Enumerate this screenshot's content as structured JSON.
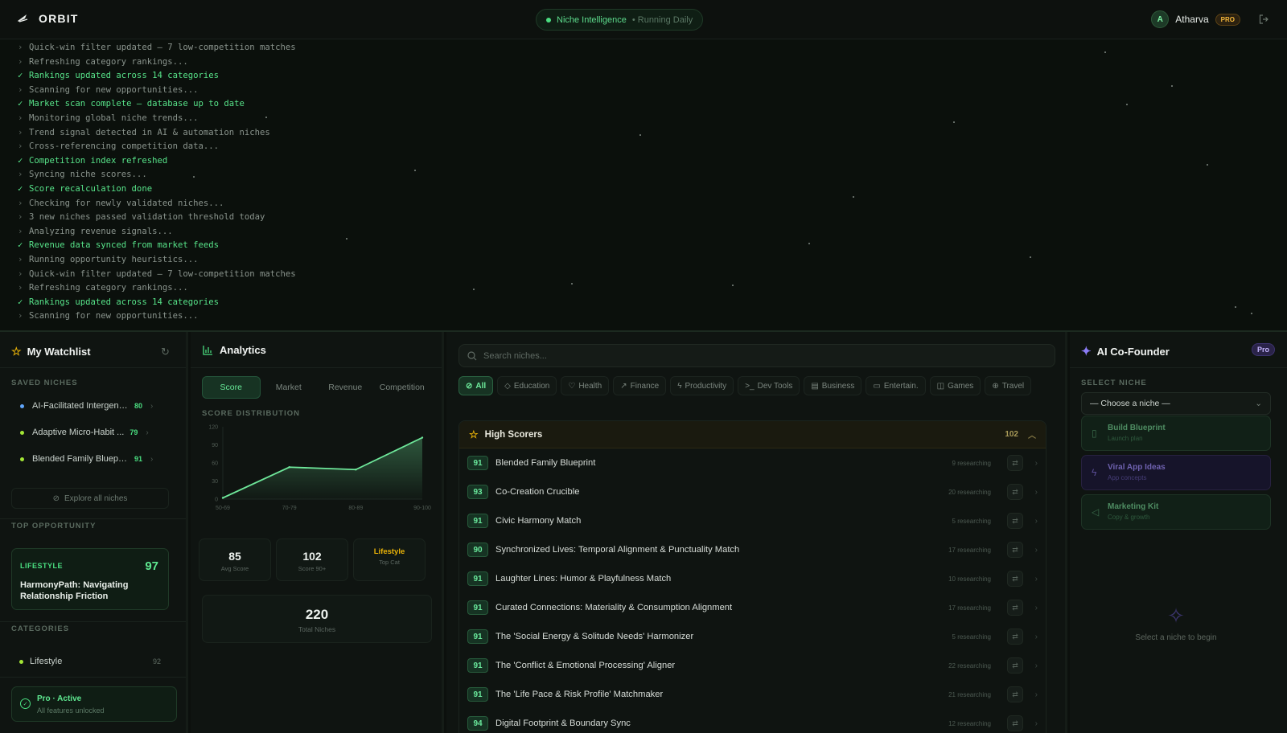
{
  "header": {
    "brand": "ORBIT",
    "status_pill": {
      "label": "Niche Intelligence",
      "sub": "• Running Daily"
    },
    "user": {
      "initial": "A",
      "name": "Atharva",
      "badge": "PRO"
    }
  },
  "terminal": {
    "lines": [
      {
        "kind": "info",
        "prefix": "›",
        "text": "Quick-win filter updated — 7 low-competition matches"
      },
      {
        "kind": "info",
        "prefix": "›",
        "text": "Refreshing category rankings..."
      },
      {
        "kind": "ok",
        "prefix": "✓",
        "text": "Rankings updated across 14 categories"
      },
      {
        "kind": "info",
        "prefix": "›",
        "text": "Scanning for new opportunities..."
      },
      {
        "kind": "ok",
        "prefix": "✓",
        "text": "Market scan complete — database up to date"
      },
      {
        "kind": "info",
        "prefix": "›",
        "text": "Monitoring global niche trends..."
      },
      {
        "kind": "info",
        "prefix": "›",
        "text": "Trend signal detected in AI & automation niches"
      },
      {
        "kind": "info",
        "prefix": "›",
        "text": "Cross-referencing competition data..."
      },
      {
        "kind": "ok",
        "prefix": "✓",
        "text": "Competition index refreshed"
      },
      {
        "kind": "info",
        "prefix": "›",
        "text": "Syncing niche scores..."
      },
      {
        "kind": "ok",
        "prefix": "✓",
        "text": "Score recalculation done"
      },
      {
        "kind": "info",
        "prefix": "›",
        "text": "Checking for newly validated niches..."
      },
      {
        "kind": "info",
        "prefix": "›",
        "text": "3 new niches passed validation threshold today"
      },
      {
        "kind": "info",
        "prefix": "›",
        "text": "Analyzing revenue signals..."
      },
      {
        "kind": "ok",
        "prefix": "✓",
        "text": "Revenue data synced from market feeds"
      },
      {
        "kind": "info",
        "prefix": "›",
        "text": "Running opportunity heuristics..."
      },
      {
        "kind": "info",
        "prefix": "›",
        "text": "Quick-win filter updated — 7 low-competition matches"
      },
      {
        "kind": "info",
        "prefix": "›",
        "text": "Refreshing category rankings..."
      },
      {
        "kind": "ok",
        "prefix": "✓",
        "text": "Rankings updated across 14 categories"
      },
      {
        "kind": "info",
        "prefix": "›",
        "text": "Scanning for new opportunities..."
      }
    ]
  },
  "watchlist": {
    "title": "My Watchlist",
    "saved_label": "SAVED NICHES",
    "saved": [
      {
        "name": "AI-Facilitated Intergene...",
        "score": "80",
        "dot": "#60a5fa"
      },
      {
        "name": "Adaptive Micro-Habit ...",
        "score": "79",
        "dot": "#a3e635"
      },
      {
        "name": "Blended Family Blueprint",
        "score": "91",
        "dot": "#a3e635"
      }
    ],
    "explore": "Explore all niches",
    "top_label": "TOP OPPORTUNITY",
    "top": {
      "category": "LIFESTYLE",
      "score": "97",
      "name": "HarmonyPath: Navigating Relationship Friction"
    },
    "categories_label": "CATEGORIES",
    "categories": [
      {
        "name": "Lifestyle",
        "count": "92"
      }
    ],
    "pro": {
      "title": "Pro · Active",
      "sub": "All features unlocked"
    }
  },
  "analytics": {
    "title": "Analytics",
    "tabs": [
      "Score",
      "Market",
      "Revenue",
      "Competition"
    ],
    "active_tab": "Score",
    "dist_label": "SCORE DISTRIBUTION",
    "stats": [
      {
        "value": "85",
        "label": "Avg Score"
      },
      {
        "value": "102",
        "label": "Score 90+"
      },
      {
        "value": "Lifestyle",
        "label": "Top Cat"
      }
    ],
    "total": {
      "value": "220",
      "label": "Total Niches"
    }
  },
  "chart_data": {
    "type": "area",
    "categories": [
      "50-69",
      "70-79",
      "80-89",
      "90-100"
    ],
    "values": [
      2,
      53,
      49,
      102
    ],
    "yticks": [
      "0",
      "30",
      "60",
      "90",
      "120"
    ],
    "ylim": [
      0,
      120
    ],
    "color": "#6ee79a"
  },
  "main": {
    "search_placeholder": "Search niches...",
    "chips": [
      {
        "label": "All",
        "icon": "⊘",
        "active": true
      },
      {
        "label": "Education",
        "icon": "◇"
      },
      {
        "label": "Health",
        "icon": "♡"
      },
      {
        "label": "Finance",
        "icon": "↗"
      },
      {
        "label": "Productivity",
        "icon": "ϟ"
      },
      {
        "label": "Dev Tools",
        "icon": ">_"
      },
      {
        "label": "Business",
        "icon": "▤"
      },
      {
        "label": "Entertain.",
        "icon": "▭"
      },
      {
        "label": "Games",
        "icon": "◫"
      },
      {
        "label": "Travel",
        "icon": "⊕"
      }
    ],
    "group": {
      "title": "High Scorers",
      "count": "102"
    },
    "rows": [
      {
        "score": "91",
        "name": "Blended Family Blueprint",
        "researching": "9 researching"
      },
      {
        "score": "93",
        "name": "Co-Creation Crucible",
        "researching": "20 researching"
      },
      {
        "score": "91",
        "name": "Civic Harmony Match",
        "researching": "5 researching"
      },
      {
        "score": "90",
        "name": "Synchronized Lives: Temporal Alignment & Punctuality Match",
        "researching": "17 researching"
      },
      {
        "score": "91",
        "name": "Laughter Lines: Humor & Playfulness Match",
        "researching": "10 researching"
      },
      {
        "score": "91",
        "name": "Curated Connections: Materiality & Consumption Alignment",
        "researching": "17 researching"
      },
      {
        "score": "91",
        "name": "The 'Social Energy & Solitude Needs' Harmonizer",
        "researching": "5 researching"
      },
      {
        "score": "91",
        "name": "The 'Conflict & Emotional Processing' Aligner",
        "researching": "22 researching"
      },
      {
        "score": "91",
        "name": "The 'Life Pace & Risk Profile' Matchmaker",
        "researching": "21 researching"
      },
      {
        "score": "94",
        "name": "Digital Footprint & Boundary Sync",
        "researching": "12 researching"
      }
    ]
  },
  "cofounder": {
    "title": "AI Co-Founder",
    "badge": "Pro",
    "select_label": "SELECT NICHE",
    "select_value": "— Choose a niche —",
    "actions": [
      {
        "title": "Build Blueprint",
        "sub": "Launch plan",
        "icon": "▯",
        "tone": "g"
      },
      {
        "title": "Viral App Ideas",
        "sub": "App concepts",
        "icon": "ϟ",
        "tone": "v"
      },
      {
        "title": "Marketing Kit",
        "sub": "Copy & growth",
        "icon": "◁",
        "tone": "g"
      }
    ],
    "empty": "Select a niche to begin"
  }
}
